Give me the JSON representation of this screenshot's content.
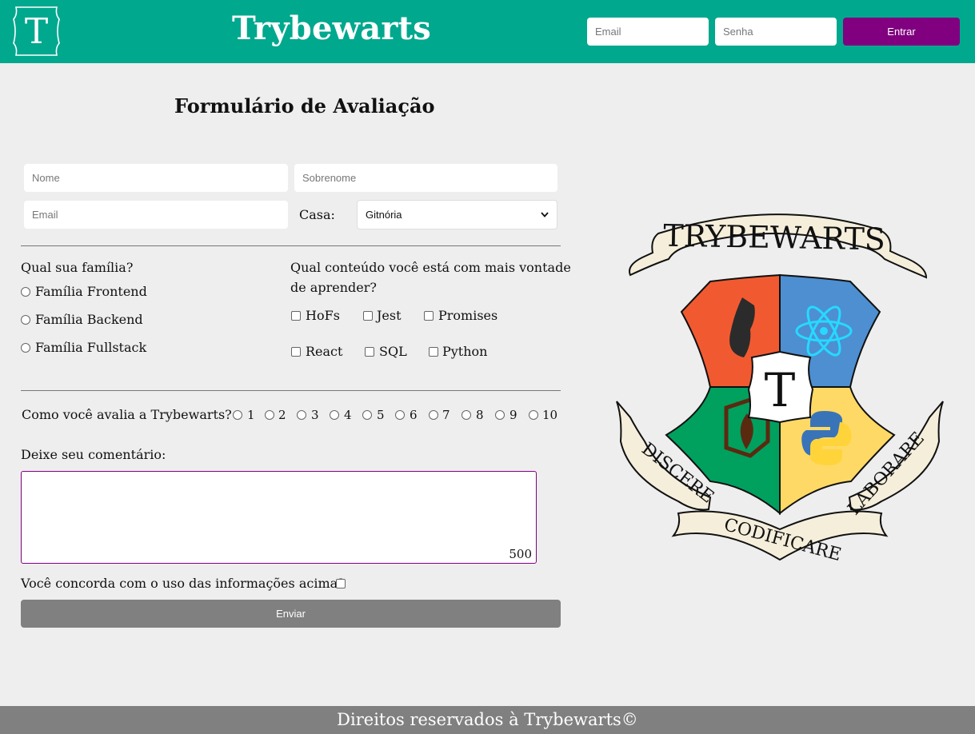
{
  "header": {
    "logo_letter": "T",
    "title": "Trybewarts",
    "email_placeholder": "Email",
    "password_placeholder": "Senha",
    "login_label": "Entrar"
  },
  "form": {
    "title": "Formulário de Avaliação",
    "name_placeholder": "Nome",
    "lastname_placeholder": "Sobrenome",
    "email_placeholder": "Email",
    "house_label": "Casa:",
    "house_selected": "Gitnória",
    "family_question": "Qual sua família?",
    "families": [
      "Família Frontend",
      "Família Backend",
      "Família Fullstack"
    ],
    "content_question_line1": "Qual conteúdo você está com mais vontade",
    "content_question_line2": "de aprender?",
    "contents": [
      "HoFs",
      "Jest",
      "Promises",
      "React",
      "SQL",
      "Python"
    ],
    "rating_question": "Como você avalia a Trybewarts?",
    "ratings": [
      "1",
      "2",
      "3",
      "4",
      "5",
      "6",
      "7",
      "8",
      "9",
      "10"
    ],
    "comment_label": "Deixe seu comentário:",
    "char_counter": "500",
    "agreement_label": "Você concorda com o uso das informações acima?",
    "submit_label": "Enviar"
  },
  "crest": {
    "top_banner": "TRYBEWARTS",
    "center_letter": "T",
    "motto_left": "DISCERE",
    "motto_center": "CODIFICARE",
    "motto_right": "LABORARE",
    "colors": {
      "red": "#f15a31",
      "blue": "#4d8fd1",
      "green": "#00a05e",
      "yellow": "#ffd965"
    }
  },
  "footer": {
    "text": "Direitos reservados à Trybewarts©"
  },
  "colors": {
    "primary": "#00a88e",
    "accent": "#800080",
    "button_gray": "#808080",
    "background": "#eeeeee"
  }
}
